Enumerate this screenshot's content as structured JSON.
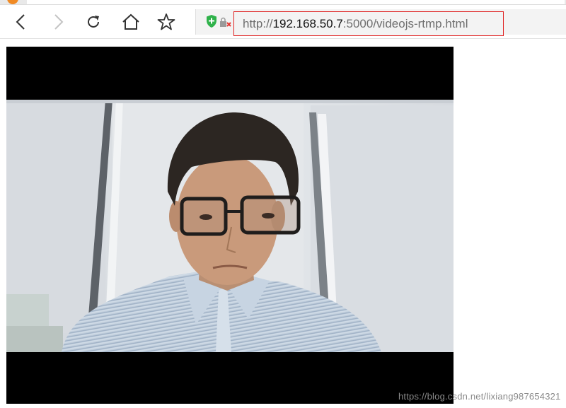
{
  "browser": {
    "url_scheme": "http://",
    "url_host": "192.168.50.7",
    "url_rest": ":5000/videojs-rtmp.html",
    "nav": {
      "back_icon": "chevron-left-icon",
      "forward_icon": "chevron-right-icon",
      "reload_icon": "reload-icon",
      "home_icon": "home-icon",
      "bookmark_icon": "star-icon",
      "security_icon": "shield-icon",
      "lock_icon": "broken-lock-icon"
    },
    "colors": {
      "url_highlight_border": "#e02020",
      "shield_green": "#2fb24a",
      "lock_red": "#e53935",
      "tab_favicon": "#f08a24"
    }
  },
  "player": {
    "background": "#000000"
  },
  "watermark": {
    "text": "https://blog.csdn.net/lixiang987654321"
  }
}
